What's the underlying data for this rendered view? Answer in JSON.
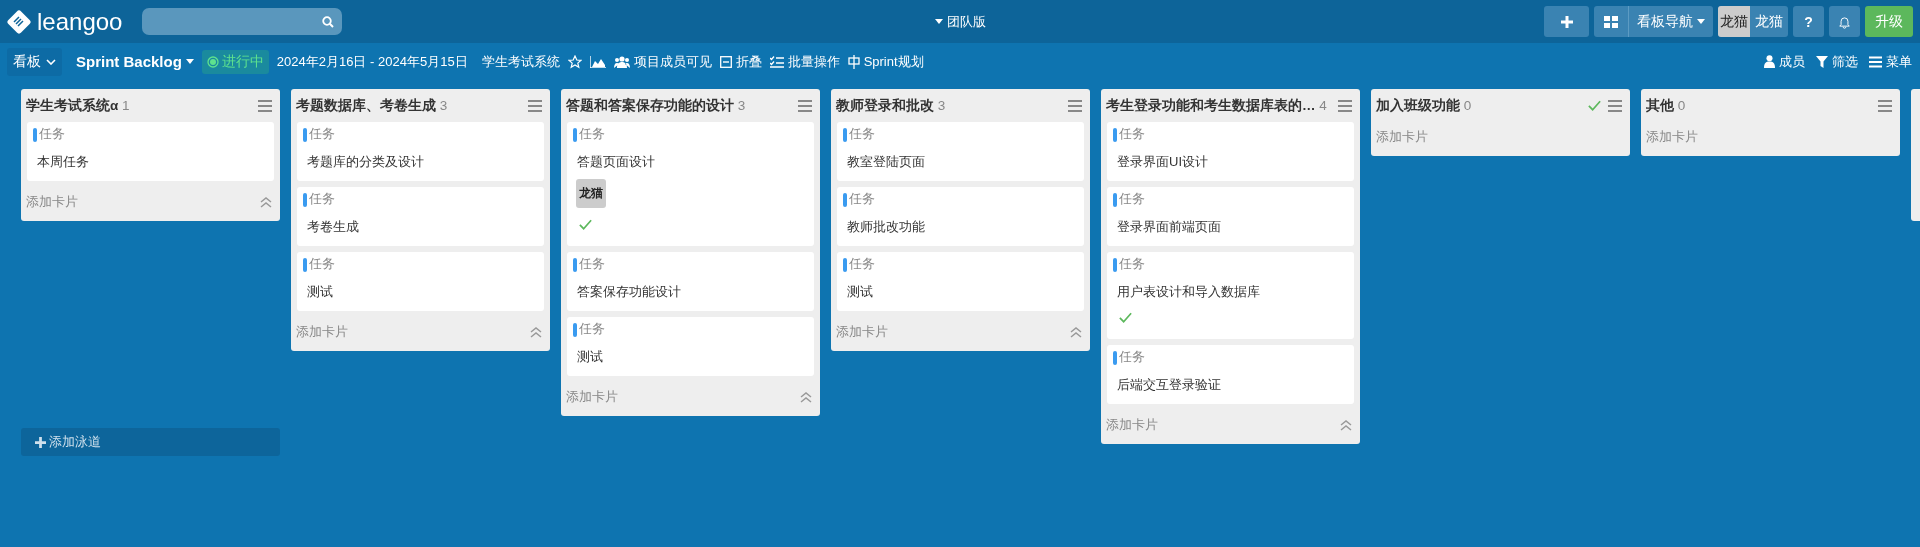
{
  "header": {
    "logo": "leangoo",
    "edition": "团队版",
    "nav_button": "看板导航",
    "avatar": "龙猫",
    "user_name": "龙猫",
    "help": "?",
    "upgrade": "升级"
  },
  "toolbar": {
    "view": "看板",
    "board": "Sprint Backlog",
    "status": "进行中",
    "dates": "2024年2月16日 - 2024年5月15日",
    "project": "学生考试系统",
    "actions": [
      {
        "kind": "members",
        "label": "项目成员可见"
      },
      {
        "kind": "collapse",
        "label": "折叠"
      },
      {
        "kind": "batch",
        "label": "批量操作"
      },
      {
        "kind": "sprint",
        "label": "Sprint规划"
      }
    ],
    "right": [
      {
        "kind": "user",
        "label": "成员"
      },
      {
        "kind": "filter",
        "label": "筛选"
      },
      {
        "kind": "menu",
        "label": "菜单"
      }
    ]
  },
  "lanes": [
    {
      "kind": "lane",
      "title": "学生考试系统α",
      "count": "1",
      "done": false,
      "add_card": "添加卡片",
      "cards": [
        {
          "tag": "任务",
          "title": "本周任务",
          "done": false
        }
      ]
    },
    {
      "kind": "lane",
      "title": "考题数据库、考卷生成",
      "count": "3",
      "done": false,
      "add_card": "添加卡片",
      "cards": [
        {
          "tag": "任务",
          "title": "考题库的分类及设计",
          "done": false
        },
        {
          "tag": "任务",
          "title": "考卷生成",
          "done": false
        },
        {
          "tag": "任务",
          "title": "测试",
          "done": false
        }
      ]
    },
    {
      "kind": "lane",
      "title": "答题和答案保存功能的设计",
      "count": "3",
      "done": false,
      "add_card": "添加卡片",
      "cards": [
        {
          "tag": "任务",
          "title": "答题页面设计",
          "assignee": "龙猫",
          "done": true
        },
        {
          "tag": "任务",
          "title": "答案保存功能设计",
          "done": false
        },
        {
          "tag": "任务",
          "title": "测试",
          "done": false
        }
      ]
    },
    {
      "kind": "lane",
      "title": "教师登录和批改",
      "count": "3",
      "done": false,
      "add_card": "添加卡片",
      "cards": [
        {
          "tag": "任务",
          "title": "教室登陆页面",
          "done": false
        },
        {
          "tag": "任务",
          "title": "教师批改功能",
          "done": false
        },
        {
          "tag": "任务",
          "title": "测试",
          "done": false
        }
      ]
    },
    {
      "kind": "lane",
      "title": "考生登录功能和考生数据库表的…",
      "count": "4",
      "done": false,
      "add_card": "添加卡片",
      "cards": [
        {
          "tag": "任务",
          "title": "登录界面UI设计",
          "done": false
        },
        {
          "tag": "任务",
          "title": "登录界面前端页面",
          "done": false
        },
        {
          "tag": "任务",
          "title": "用户表设计和导入数据库",
          "done": true
        },
        {
          "tag": "任务",
          "title": "后端交互登录验证",
          "done": false
        }
      ]
    },
    {
      "kind": "lane",
      "title": "加入班级功能",
      "count": "0",
      "done": true,
      "add_card": "添加卡片"
    },
    {
      "kind": "lane",
      "title": "其他",
      "count": "0",
      "done": false,
      "add_card": "添加卡片"
    },
    {
      "kind": "cut-off"
    }
  ],
  "add_lane": "添加泳道"
}
